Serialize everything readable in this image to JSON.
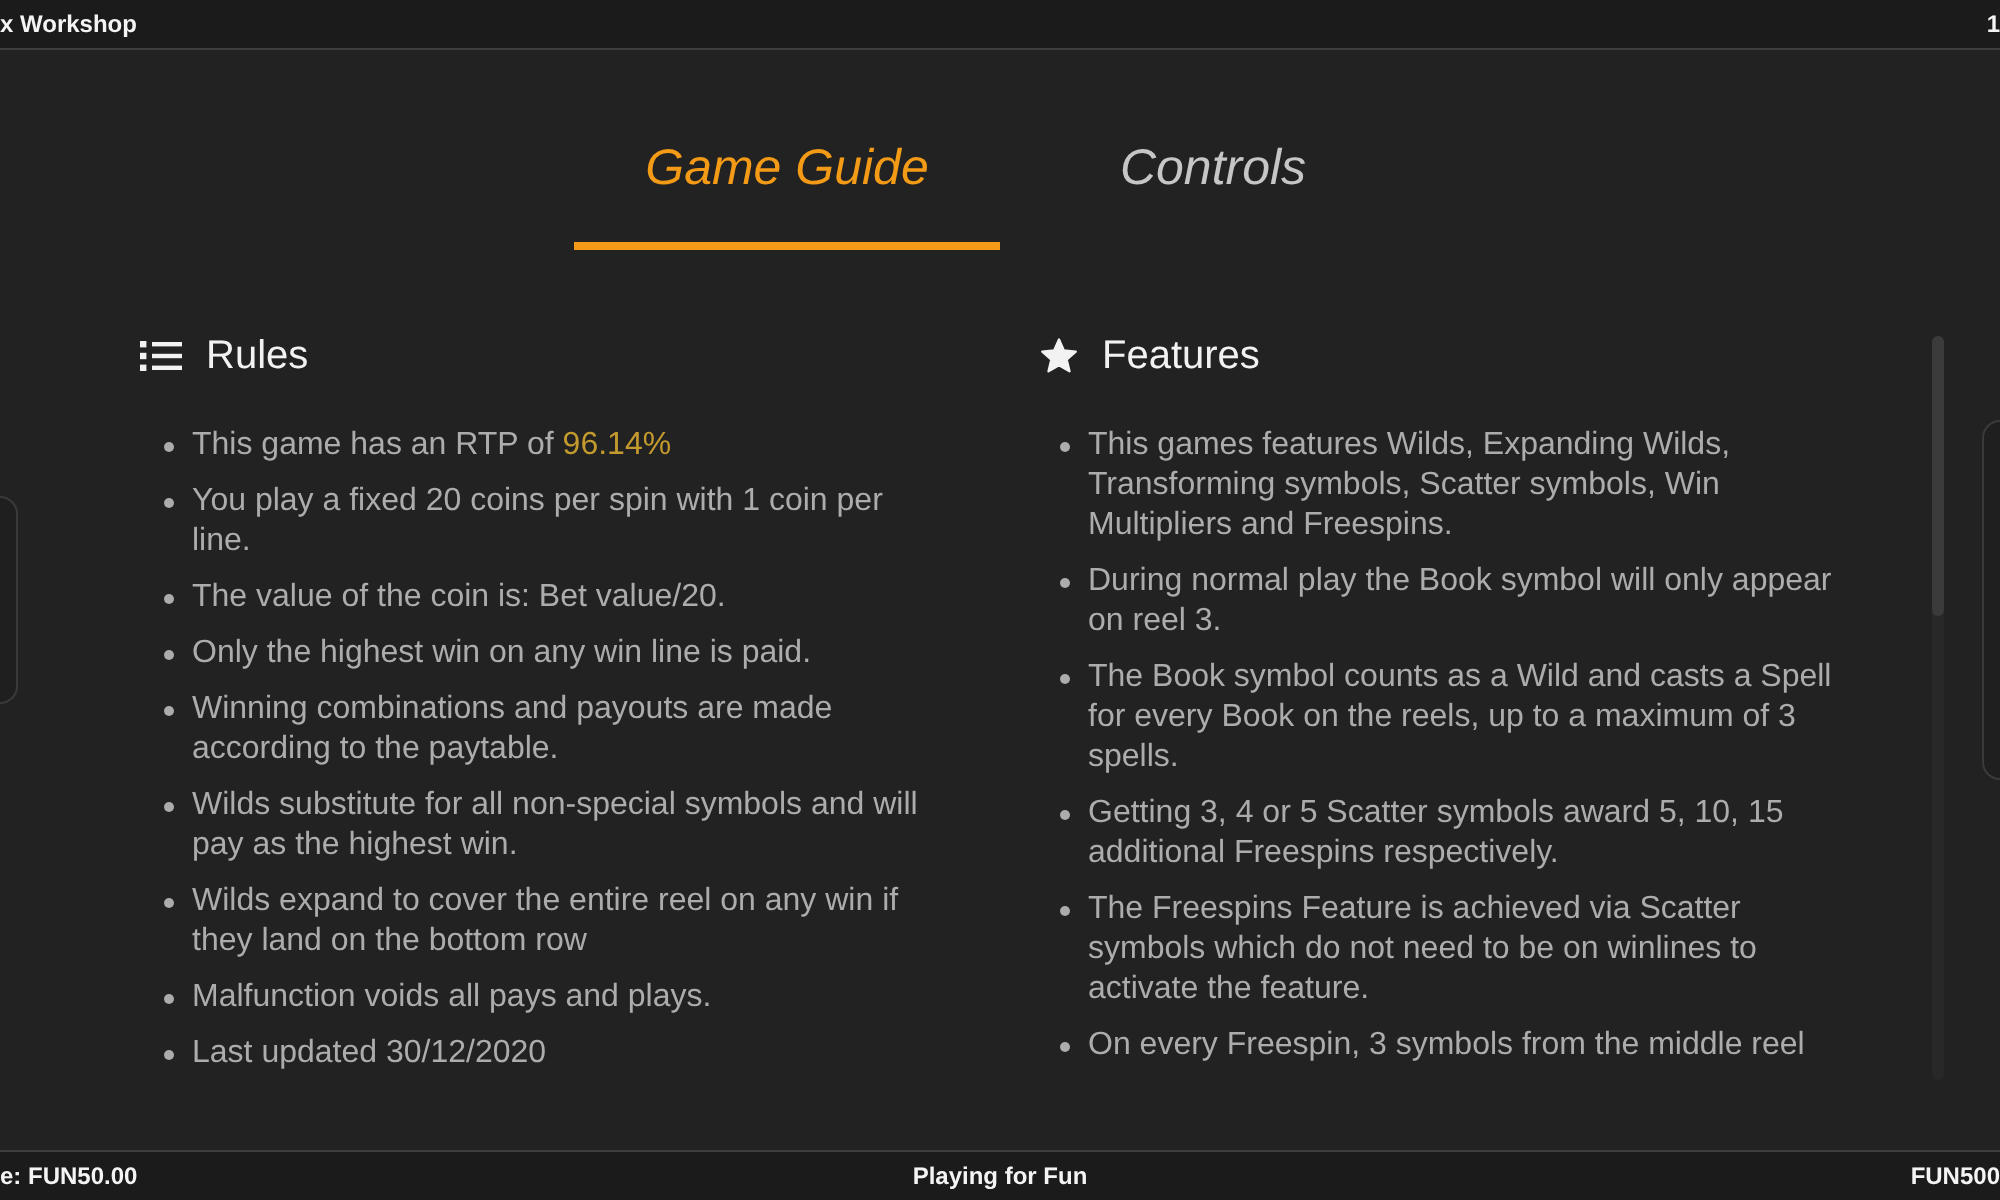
{
  "top_bar": {
    "title": "x Workshop",
    "right_text": "1"
  },
  "tabs": [
    {
      "label": "Game Guide",
      "selected": true
    },
    {
      "label": "Controls",
      "selected": false
    }
  ],
  "rules": {
    "heading": "Rules",
    "items": [
      {
        "text": "This game has an RTP of",
        "highlight": "96.14%"
      },
      {
        "text": "You play a fixed 20 coins per spin with 1 coin per line."
      },
      {
        "text": "The value of the coin is: Bet value/20."
      },
      {
        "text": "Only the highest win on any win line is paid."
      },
      {
        "text": "Winning combinations and payouts are made according to the paytable."
      },
      {
        "text": "Wilds substitute for all non-special symbols and will pay as the highest win."
      },
      {
        "text": "Wilds expand to cover the entire reel on any win if they land on the bottom row"
      },
      {
        "text": "Malfunction voids all pays and plays."
      },
      {
        "text": "Last updated 30/12/2020"
      }
    ]
  },
  "features": {
    "heading": "Features",
    "items": [
      {
        "text": "This games features Wilds, Expanding Wilds, Transforming symbols, Scatter symbols, Win Multipliers and Freespins."
      },
      {
        "text": "During normal play the Book symbol will only appear on reel 3."
      },
      {
        "text": "The Book symbol counts as a Wild and casts a Spell for every Book on the reels, up to a maximum of 3 spells."
      },
      {
        "text": "Getting 3, 4 or 5 Scatter symbols award 5, 10, 15 additional Freespins respectively."
      },
      {
        "text": "The Freespins Feature is achieved via Scatter symbols which do not need to be on winlines to activate the feature."
      },
      {
        "text": "On every Freespin, 3 symbols from the middle reel"
      }
    ]
  },
  "status_bar": {
    "left_text": "e: FUN50.00",
    "center_text": "Playing for Fun",
    "right_text": "FUN500"
  }
}
